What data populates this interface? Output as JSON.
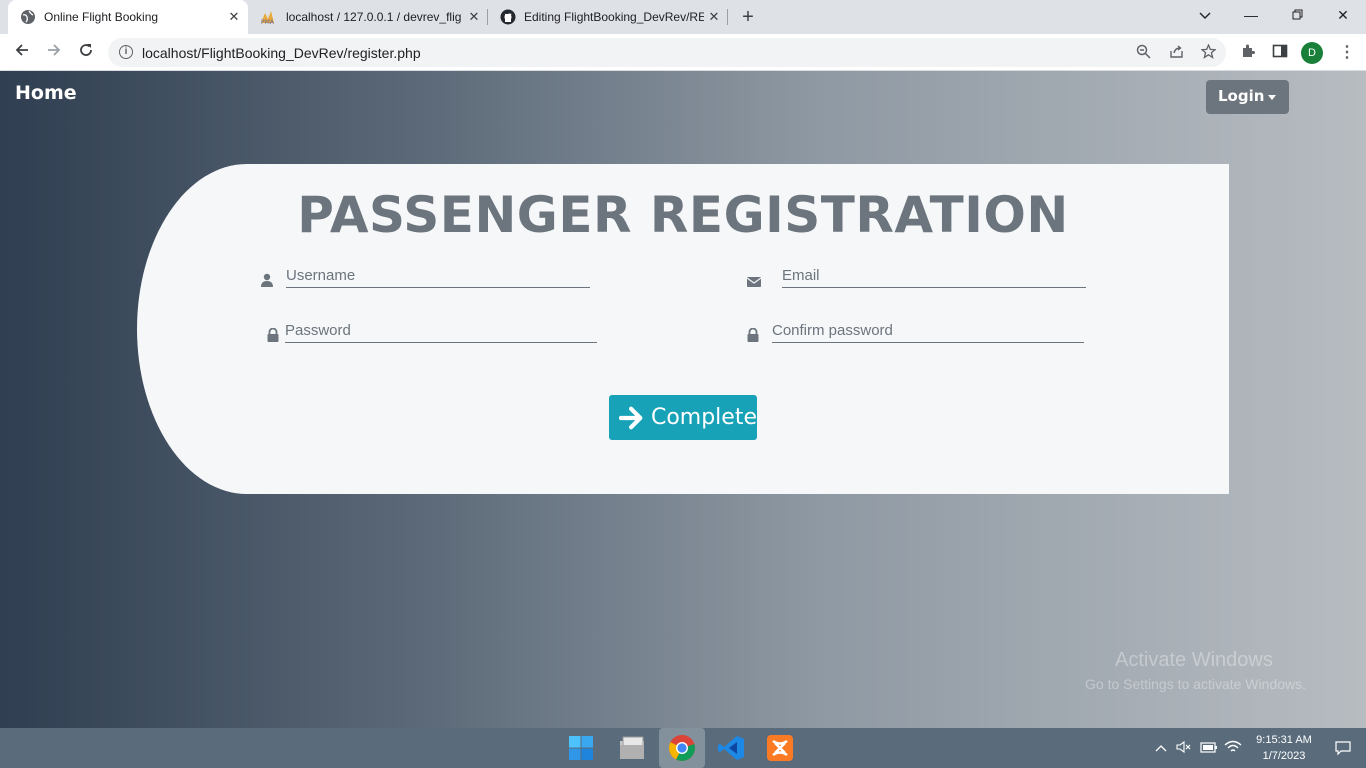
{
  "browser": {
    "tabs": [
      {
        "title": "Online Flight Booking",
        "active": true
      },
      {
        "title": "localhost / 127.0.0.1 / devrev_flig",
        "active": false
      },
      {
        "title": "Editing FlightBooking_DevRev/RE",
        "active": false
      }
    ],
    "url": "localhost/FlightBooking_DevRev/register.php",
    "profile_initial": "D"
  },
  "nav": {
    "home_label": "Home",
    "login_label": "Login"
  },
  "form": {
    "title": "PASSENGER REGISTRATION",
    "username_placeholder": "Username",
    "email_placeholder": "Email",
    "password_placeholder": "Password",
    "confirm_placeholder": "Confirm password",
    "submit_label": "Complete"
  },
  "watermark": {
    "line1": "Activate Windows",
    "line2": "Go to Settings to activate Windows."
  },
  "taskbar": {
    "time": "9:15:31 AM",
    "date": "1/7/2023"
  },
  "colors": {
    "accent": "#17a2b8",
    "secondary": "#6c757d",
    "card": "#f5f7f9"
  }
}
